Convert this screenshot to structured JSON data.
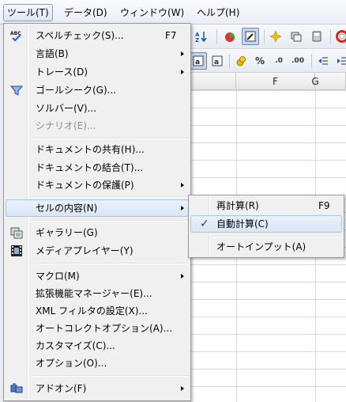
{
  "menubar": {
    "items": [
      {
        "label": "ツール(T)",
        "active": true
      },
      {
        "label": "データ(D)",
        "active": false
      },
      {
        "label": "ウィンドウ(W)",
        "active": false
      },
      {
        "label": "ヘルプ(H)",
        "active": false
      }
    ]
  },
  "sheet": {
    "columns": [
      "F",
      "G"
    ]
  },
  "toolbar": {
    "percent_label": "%",
    "decimal_add_label": ".0",
    "decimal_remove_label": ".00"
  },
  "tools_menu": {
    "items": [
      {
        "label": "スペルチェック(S)...",
        "shortcut": "F7",
        "icon": "spellcheck-icon"
      },
      {
        "label": "言語(B)",
        "submenu": true
      },
      {
        "label": "トレース(D)",
        "submenu": true
      },
      {
        "label": "ゴールシーク(G)...",
        "icon": "goal-seek-icon"
      },
      {
        "label": "ソルバー(V)..."
      },
      {
        "label": "シナリオ(E)...",
        "disabled": true
      },
      {
        "label": "ドキュメントの共有(H)..."
      },
      {
        "label": "ドキュメントの結合(T)..."
      },
      {
        "label": "ドキュメントの保護(P)",
        "submenu": true
      },
      {
        "label": "セルの内容(N)",
        "submenu": true,
        "highlighted": true
      },
      {
        "label": "ギャラリー(G)",
        "icon": "gallery-icon"
      },
      {
        "label": "メディアプレイヤー(Y)",
        "icon": "media-player-icon"
      },
      {
        "label": "マクロ(M)",
        "submenu": true
      },
      {
        "label": "拡張機能マネージャー(E)..."
      },
      {
        "label": "XML フィルタの設定(X)..."
      },
      {
        "label": "オートコレクトオプション(A)..."
      },
      {
        "label": "カスタマイズ(C)..."
      },
      {
        "label": "オプション(O)..."
      },
      {
        "label": "アドオン(F)",
        "submenu": true,
        "icon": "addons-icon"
      }
    ]
  },
  "cell_contents_submenu": {
    "items": [
      {
        "label": "再計算(R)",
        "shortcut": "F9"
      },
      {
        "label": "自動計算(C)",
        "checked": true
      },
      {
        "label": "オートインプット(A)"
      }
    ]
  },
  "colors": {
    "highlight_border": "#a8c4e6",
    "highlight_fill": "#dce9f7",
    "menu_background": "#f0f0f0"
  }
}
